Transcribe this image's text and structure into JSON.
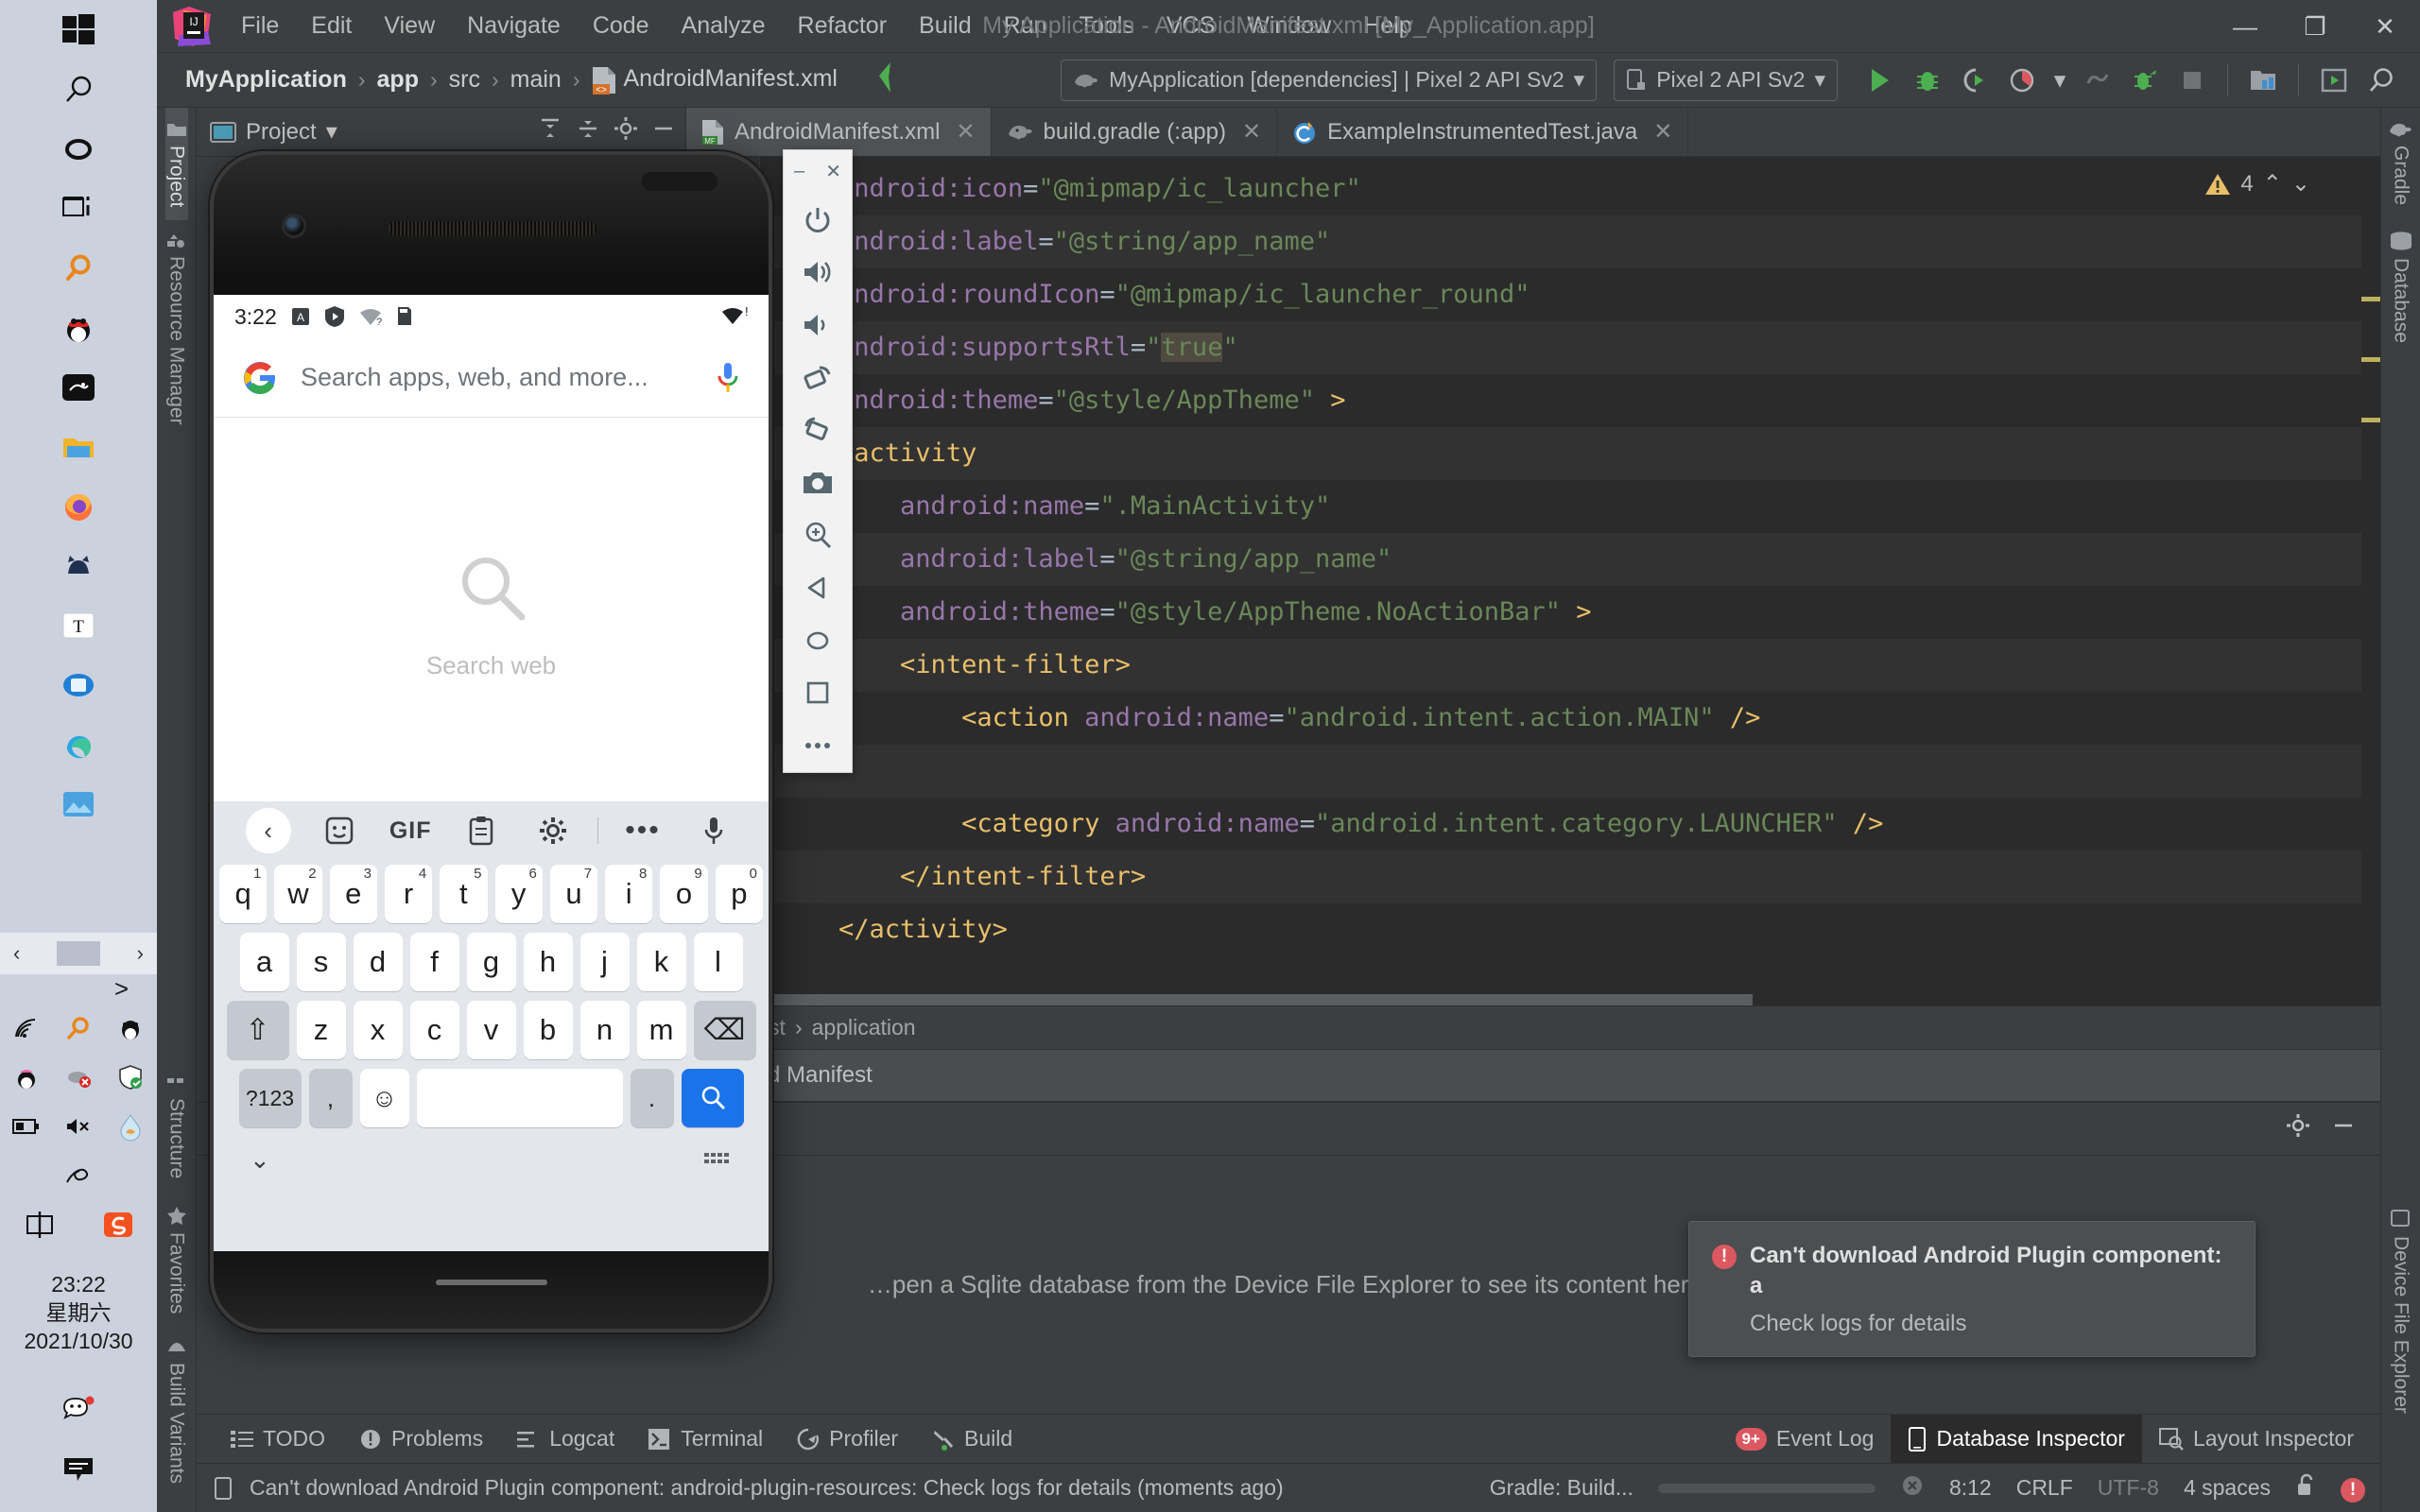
{
  "taskbar": {
    "apps": [
      {
        "name": "start-button",
        "label": "Start"
      },
      {
        "name": "search-icon",
        "label": "Search"
      },
      {
        "name": "cortana-icon",
        "label": "Cortana"
      },
      {
        "name": "task-view-icon",
        "label": "Task View"
      },
      {
        "name": "everything-search-icon",
        "label": "Everything"
      },
      {
        "name": "qq-icon",
        "label": "QQ"
      },
      {
        "name": "snip-icon",
        "label": "Snipaste"
      },
      {
        "name": "file-explorer-icon",
        "label": "File Explorer"
      },
      {
        "name": "firefox-icon",
        "label": "Firefox"
      },
      {
        "name": "cat-app-icon",
        "label": "Cat App"
      },
      {
        "name": "text-editor-icon",
        "label": "Text Editor"
      },
      {
        "name": "monitor-app-icon",
        "label": "Monitor"
      },
      {
        "name": "edge-icon",
        "label": "Microsoft Edge"
      },
      {
        "name": "photos-icon",
        "label": "Photos"
      }
    ],
    "tray": [
      {
        "name": "network-icon",
        "label": "Network"
      },
      {
        "name": "everything-tray-icon",
        "label": "Everything"
      },
      {
        "name": "qq-tray-icon",
        "label": "QQ"
      },
      {
        "name": "qq-penguin-tray-icon",
        "label": "QQ Penguin"
      },
      {
        "name": "mouse-disabled-icon",
        "label": "Mouse"
      },
      {
        "name": "security-shield-icon",
        "label": "Security"
      },
      {
        "name": "battery-icon",
        "label": "Battery"
      },
      {
        "name": "volume-mute-icon",
        "label": "Volume muted"
      },
      {
        "name": "water-drop-icon",
        "label": "Drop"
      },
      {
        "name": "pen-icon",
        "label": "Pen"
      },
      {
        "name": "ime-chinese-icon",
        "label": "中"
      },
      {
        "name": "sogou-icon",
        "label": "Sogou"
      }
    ],
    "clock": {
      "time": "23:22",
      "weekday": "星期六",
      "date": "2021/10/30"
    },
    "wechat": "WeChat",
    "notifications": "Notifications",
    "scroll_left": "‹",
    "scroll_right": "›"
  },
  "window": {
    "title": "My Application - AndroidManifest.xml [My_Application.app]",
    "minimize": "—",
    "maximize": "❐",
    "close": "✕"
  },
  "menu": {
    "items": [
      {
        "label": "File"
      },
      {
        "label": "Edit"
      },
      {
        "label": "View"
      },
      {
        "label": "Navigate"
      },
      {
        "label": "Code"
      },
      {
        "label": "Analyze"
      },
      {
        "label": "Refactor"
      },
      {
        "label": "Build"
      },
      {
        "label": "Run"
      },
      {
        "label": "Tools"
      },
      {
        "label": "VCS"
      },
      {
        "label": "Window"
      },
      {
        "label": "Help"
      }
    ]
  },
  "navbar": {
    "breadcrumbs": [
      {
        "label": "MyApplication",
        "bold": true
      },
      {
        "label": "app",
        "bold": true
      },
      {
        "label": "src",
        "bold": false
      },
      {
        "label": "main",
        "bold": false
      },
      {
        "label": "AndroidManifest.xml",
        "bold": false
      }
    ],
    "separator": "›",
    "run_config": "MyApplication [dependencies] | Pixel 2 API Sv2",
    "device": "Pixel 2 API Sv2",
    "dropdown_caret": "▾",
    "buttons": [
      {
        "name": "run-button",
        "label": "Run"
      },
      {
        "name": "debug-button",
        "label": "Debug"
      },
      {
        "name": "run-coverage-button",
        "label": "Run with Coverage"
      },
      {
        "name": "profile-button",
        "label": "Profile"
      },
      {
        "name": "attach-debugger-button",
        "label": "Attach Debugger"
      },
      {
        "name": "apply-changes-button",
        "label": "Apply Changes"
      },
      {
        "name": "stop-button",
        "label": "Stop"
      },
      {
        "name": "sdk-manager-button",
        "label": "SDK Manager"
      },
      {
        "name": "avd-manager-button",
        "label": "AVD Manager"
      },
      {
        "name": "search-everywhere-button",
        "label": "Search Everywhere"
      }
    ]
  },
  "left_strip": {
    "top": [
      {
        "label": "Project",
        "active": true,
        "icon": "project-icon"
      },
      {
        "label": "Resource Manager",
        "active": false,
        "icon": "resource-manager-icon"
      }
    ],
    "bottom": [
      {
        "label": "Structure",
        "icon": "structure-icon"
      },
      {
        "label": "Favorites",
        "icon": "star-icon"
      },
      {
        "label": "Build Variants",
        "icon": "build-variants-icon"
      }
    ]
  },
  "right_strip": {
    "top": [
      {
        "label": "Gradle",
        "icon": "gradle-elephant-icon"
      },
      {
        "label": "Database",
        "icon": "database-icon"
      }
    ],
    "bottom": [
      {
        "label": "Device File Explorer",
        "icon": "device-file-explorer-icon"
      }
    ]
  },
  "project_panel": {
    "title": "Project",
    "caret": "▾",
    "actions": [
      {
        "name": "collapse-all-icon",
        "label": "Collapse All"
      },
      {
        "name": "expand-all-icon",
        "label": "Expand All"
      },
      {
        "name": "settings-gear-icon",
        "label": "Settings"
      },
      {
        "name": "hide-panel-icon",
        "label": "Hide"
      }
    ]
  },
  "editor": {
    "tabs": [
      {
        "label": "AndroidManifest.xml",
        "icon": "manifest-file-icon",
        "active": true,
        "close": "✕"
      },
      {
        "label": "build.gradle (:app)",
        "icon": "gradle-file-icon",
        "active": false,
        "close": "✕"
      },
      {
        "label": "ExampleInstrumentedTest.java",
        "icon": "class-file-icon",
        "active": false,
        "close": "✕"
      }
    ],
    "warning_count": "4",
    "warning_up": "⌃",
    "warning_down": "⌄",
    "lines": [
      {
        "indent": 2,
        "segments": [
          {
            "t": "android:icon",
            "c": "attr"
          },
          {
            "t": "=",
            "c": "eq"
          },
          {
            "t": "\"@mipmap/ic_launcher\"",
            "c": "str"
          }
        ]
      },
      {
        "indent": 2,
        "segments": [
          {
            "t": "android:label",
            "c": "attr"
          },
          {
            "t": "=",
            "c": "eq"
          },
          {
            "t": "\"@string/app_name\"",
            "c": "str"
          }
        ]
      },
      {
        "indent": 2,
        "segments": [
          {
            "t": "android:roundIcon",
            "c": "attr"
          },
          {
            "t": "=",
            "c": "eq"
          },
          {
            "t": "\"@mipmap/ic_launcher_round\"",
            "c": "str"
          }
        ]
      },
      {
        "indent": 2,
        "segments": [
          {
            "t": "android:supportsRtl",
            "c": "attr"
          },
          {
            "t": "=",
            "c": "eq"
          },
          {
            "t": "\"",
            "c": "str"
          },
          {
            "t": "true",
            "c": "str hl"
          },
          {
            "t": "\"",
            "c": "str"
          }
        ]
      },
      {
        "indent": 2,
        "segments": [
          {
            "t": "android:theme",
            "c": "attr"
          },
          {
            "t": "=",
            "c": "eq"
          },
          {
            "t": "\"@style/AppTheme\"",
            "c": "str"
          },
          {
            "t": " >",
            "c": "tagp"
          }
        ]
      },
      {
        "indent": 2,
        "segments": [
          {
            "t": "<activity",
            "c": "tagn"
          }
        ]
      },
      {
        "indent": 4,
        "segments": [
          {
            "t": "android:name",
            "c": "attr"
          },
          {
            "t": "=",
            "c": "eq"
          },
          {
            "t": "\".MainActivity\"",
            "c": "str"
          }
        ]
      },
      {
        "indent": 4,
        "segments": [
          {
            "t": "android:label",
            "c": "attr"
          },
          {
            "t": "=",
            "c": "eq"
          },
          {
            "t": "\"@string/app_name\"",
            "c": "str"
          }
        ]
      },
      {
        "indent": 4,
        "segments": [
          {
            "t": "android:theme",
            "c": "attr"
          },
          {
            "t": "=",
            "c": "eq"
          },
          {
            "t": "\"@style/AppTheme.NoActionBar\"",
            "c": "str"
          },
          {
            "t": " >",
            "c": "tagp"
          }
        ]
      },
      {
        "indent": 4,
        "segments": [
          {
            "t": "<intent-filter>",
            "c": "tagn"
          }
        ]
      },
      {
        "indent": 6,
        "segments": [
          {
            "t": "<action ",
            "c": "tagn"
          },
          {
            "t": "android:name",
            "c": "attr"
          },
          {
            "t": "=",
            "c": "eq"
          },
          {
            "t": "\"android.intent.action.MAIN\"",
            "c": "str"
          },
          {
            "t": " />",
            "c": "tagp"
          }
        ]
      },
      {
        "indent": 6,
        "segments": []
      },
      {
        "indent": 6,
        "segments": [
          {
            "t": "<category ",
            "c": "tagn"
          },
          {
            "t": "android:name",
            "c": "attr"
          },
          {
            "t": "=",
            "c": "eq"
          },
          {
            "t": "\"android.intent.category.LAUNCHER\"",
            "c": "str"
          },
          {
            "t": " />",
            "c": "tagp"
          }
        ]
      },
      {
        "indent": 4,
        "segments": [
          {
            "t": "</intent-filter>",
            "c": "tagn"
          }
        ]
      },
      {
        "indent": 2,
        "segments": [
          {
            "t": "</activity>",
            "c": "tagn"
          }
        ]
      }
    ],
    "breadcrumb": [
      "manifest",
      "application"
    ],
    "breadcrumb_sep": "›"
  },
  "merged_manifest": {
    "label": "Merged Manifest"
  },
  "db_inspector": {
    "message": "…pen a Sqlite database from the Device File Explorer to see its content here.",
    "settings_icon": "settings-gear-icon",
    "hide_icon": "hide-panel-icon"
  },
  "balloon": {
    "icon": "error-icon",
    "title": "Can't download Android Plugin component: a",
    "subtitle": "Check logs for details"
  },
  "bottom_toolwindows": {
    "left": [
      {
        "label": "TODO",
        "icon": "todo-icon",
        "active": false
      },
      {
        "label": "Problems",
        "icon": "problems-icon",
        "active": false
      },
      {
        "label": "Logcat",
        "icon": "logcat-icon",
        "active": false
      },
      {
        "label": "Terminal",
        "icon": "terminal-icon",
        "active": false
      },
      {
        "label": "Profiler",
        "icon": "profiler-icon",
        "active": false
      },
      {
        "label": "Build",
        "icon": "build-hammer-icon",
        "active": false
      }
    ],
    "right": [
      {
        "label": "Event Log",
        "icon": "event-log-icon",
        "badge": "9+",
        "active": false
      },
      {
        "label": "Database Inspector",
        "icon": "database-inspector-icon",
        "active": true
      },
      {
        "label": "Layout Inspector",
        "icon": "layout-inspector-icon",
        "active": false
      }
    ]
  },
  "statusbar": {
    "icon": "status-message-icon",
    "message": "Can't download Android Plugin component: android-plugin-resources: Check logs for details (moments ago)",
    "gradle_task": "Gradle: Build...",
    "cancel": "✕",
    "caret_position": "8:12",
    "line_separator": "CRLF",
    "encoding": "UTF-8",
    "indent": "4 spaces",
    "lock_icon": "unlocked-icon",
    "error_icon": "error-icon"
  },
  "emulator": {
    "toolbar": {
      "minimize": "–",
      "close": "✕",
      "buttons": [
        {
          "name": "power-icon",
          "label": "Power"
        },
        {
          "name": "volume-up-icon",
          "label": "Volume Up"
        },
        {
          "name": "volume-down-icon",
          "label": "Volume Down"
        },
        {
          "name": "rotate-left-icon",
          "label": "Rotate Left"
        },
        {
          "name": "rotate-right-icon",
          "label": "Rotate Right"
        },
        {
          "name": "screenshot-camera-icon",
          "label": "Take Screenshot"
        },
        {
          "name": "zoom-in-icon",
          "label": "Zoom"
        },
        {
          "name": "back-nav-icon",
          "label": "Back"
        },
        {
          "name": "home-nav-icon",
          "label": "Home"
        },
        {
          "name": "overview-nav-icon",
          "label": "Overview"
        },
        {
          "name": "extended-controls-icon",
          "label": "More"
        }
      ]
    },
    "screen": {
      "status_time": "3:22",
      "status_icons": [
        {
          "name": "vibrate-icon",
          "label": "A"
        },
        {
          "name": "play-protect-icon",
          "label": "Play Protect"
        },
        {
          "name": "wifi-unknown-icon",
          "label": "Wi-Fi ?"
        },
        {
          "name": "sim-card-icon",
          "label": "SIM"
        }
      ],
      "status_right": [
        {
          "name": "wifi-alert-icon",
          "label": "Wi-Fi !"
        }
      ],
      "search_placeholder": "Search apps, web, and more...",
      "google_logo": "G",
      "mic_icon": "mic-icon",
      "empty_label": "Search web",
      "empty_icon": "search-magnifier-icon"
    },
    "keyboard": {
      "toolbar": [
        {
          "name": "kb-back-icon",
          "label": "‹"
        },
        {
          "name": "kb-sticker-icon",
          "label": "Sticker"
        },
        {
          "name": "kb-gif-icon",
          "label": "GIF"
        },
        {
          "name": "kb-clipboard-icon",
          "label": "Clipboard"
        },
        {
          "name": "kb-settings-icon",
          "label": "Settings"
        },
        {
          "name": "kb-more-icon",
          "label": "•••"
        },
        {
          "name": "kb-mic-icon",
          "label": "Mic"
        }
      ],
      "row1": [
        {
          "k": "q",
          "n": "1"
        },
        {
          "k": "w",
          "n": "2"
        },
        {
          "k": "e",
          "n": "3"
        },
        {
          "k": "r",
          "n": "4"
        },
        {
          "k": "t",
          "n": "5"
        },
        {
          "k": "y",
          "n": "6"
        },
        {
          "k": "u",
          "n": "7"
        },
        {
          "k": "i",
          "n": "8"
        },
        {
          "k": "o",
          "n": "9"
        },
        {
          "k": "p",
          "n": "0"
        }
      ],
      "row2": [
        "a",
        "s",
        "d",
        "f",
        "g",
        "h",
        "j",
        "k",
        "l"
      ],
      "row3": {
        "shift": "⇧",
        "keys": [
          "z",
          "x",
          "c",
          "v",
          "b",
          "n",
          "m"
        ],
        "backspace": "⌫"
      },
      "row4": {
        "symbols": "?123",
        "comma": ",",
        "emoji": "☺",
        "space": "",
        "period": ".",
        "go": "search-icon"
      },
      "bottom": {
        "hide": "⌄",
        "resize": "keyboard-handle-icon"
      }
    }
  }
}
